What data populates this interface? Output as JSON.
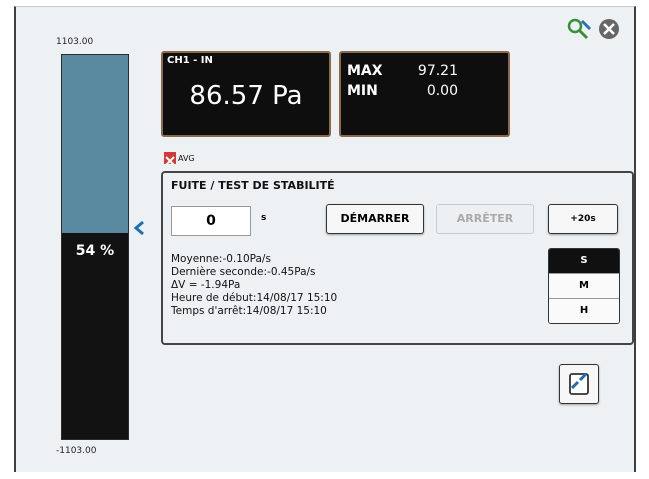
{
  "toolbar": {
    "tool_icon": "wrench-magnifier-icon",
    "close_icon": "close-icon"
  },
  "gauge": {
    "max_label": "1103.00",
    "min_label": "-1103.00",
    "percent_label": "54 %",
    "level_fraction": 0.46
  },
  "channel": {
    "label": "CH1 - IN",
    "value": "86.57 Pa"
  },
  "minmax": {
    "max_label": "MAX",
    "max_value": "97.21",
    "min_label": "MIN",
    "min_value": "0.00"
  },
  "avg": {
    "label": "AVG",
    "checked": false
  },
  "leak_test": {
    "title": "FUITE / TEST DE STABILITÉ",
    "field_value": "0",
    "unit": "s",
    "start_label": "DÉMARRER",
    "stop_label": "ARRÊTER",
    "plus_label": "+20s",
    "stats": [
      "Moyenne:-0.10Pa/s",
      "Dernière seconde:-0.45Pa/s",
      "ΔV = -1.94Pa",
      "Heure de début:14/08/17 15:10",
      "Temps d'arrêt:14/08/17 15:10"
    ],
    "units_toggle": [
      {
        "label": "S",
        "active": true
      },
      {
        "label": "M",
        "active": false
      },
      {
        "label": "H",
        "active": false
      }
    ]
  },
  "bottom": {
    "icon": "swap-icon"
  },
  "colors": {
    "gauge_fill": "#5a8aa0",
    "accent": "#1f6fb5",
    "box_border": "#8a6a4a"
  }
}
